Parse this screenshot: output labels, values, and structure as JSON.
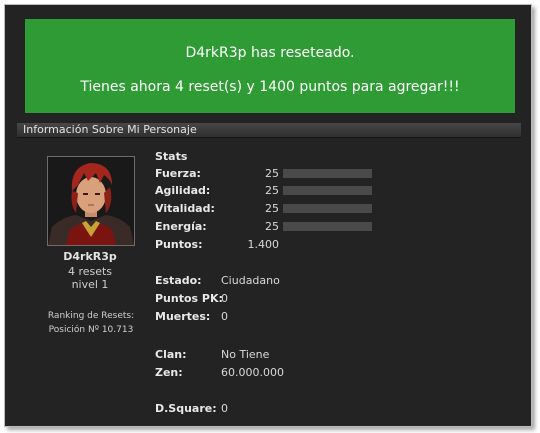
{
  "banner": {
    "line1": "D4rkR3p has reseteado.",
    "line2": "Tienes ahora 4 reset(s) y 1400 puntos para agregar!!!",
    "color": "#2e9b35"
  },
  "section_title": "Información Sobre Mi Personaje",
  "character": {
    "name": "D4rkR3p",
    "resets": "4 resets",
    "level": "nivel 1",
    "ranking_label": "Ranking de Resets:",
    "ranking_position": "Posición Nº 10.713"
  },
  "stats": {
    "heading": "Stats",
    "fuerza": {
      "label": "Fuerza:",
      "value": "25",
      "fill": 0.0
    },
    "agilidad": {
      "label": "Agilidad:",
      "value": "25",
      "fill": 0.0
    },
    "vitalidad": {
      "label": "Vitalidad:",
      "value": "25",
      "fill": 0.0
    },
    "energia": {
      "label": "Energía:",
      "value": "25",
      "fill": 0.0
    },
    "puntos": {
      "label": "Puntos:",
      "value": "1.400"
    }
  },
  "info": {
    "estado": {
      "label": "Estado:",
      "value": "Ciudadano"
    },
    "puntos_pk": {
      "label": "Puntos PK:",
      "value": "0"
    },
    "muertes": {
      "label": "Muertes:",
      "value": "0"
    },
    "clan": {
      "label": "Clan:",
      "value": "No Tiene"
    },
    "zen": {
      "label": "Zen:",
      "value": "60.000.000"
    },
    "dsquare": {
      "label": "D.Square:",
      "value": "0"
    }
  }
}
